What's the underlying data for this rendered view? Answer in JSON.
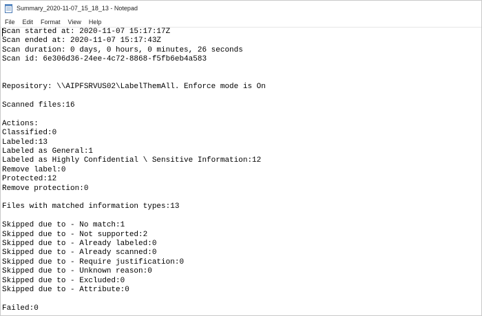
{
  "window": {
    "title": "Summary_2020-11-07_15_18_13 - Notepad"
  },
  "menu": {
    "items": [
      "File",
      "Edit",
      "Format",
      "View",
      "Help"
    ]
  },
  "document": {
    "lines": [
      "Scan started at: 2020-11-07 15:17:17Z",
      "Scan ended at: 2020-11-07 15:17:43Z",
      "Scan duration: 0 days, 0 hours, 0 minutes, 26 seconds",
      "Scan id: 6e306d36-24ee-4c72-8868-f5fb6eb4a583",
      "",
      "",
      "Repository: \\\\AIPFSRVUS02\\LabelThemAll. Enforce mode is On",
      "",
      "Scanned files:16",
      "",
      "Actions:",
      "Classified:0",
      "Labeled:13",
      "Labeled as General:1",
      "Labeled as Highly Confidential \\ Sensitive Information:12",
      "Remove label:0",
      "Protected:12",
      "Remove protection:0",
      "",
      "Files with matched information types:13",
      "",
      "Skipped due to - No match:1",
      "Skipped due to - Not supported:2",
      "Skipped due to - Already labeled:0",
      "Skipped due to - Already scanned:0",
      "Skipped due to - Require justification:0",
      "Skipped due to - Unknown reason:0",
      "Skipped due to - Excluded:0",
      "Skipped due to - Attribute:0",
      "",
      "Failed:0"
    ]
  },
  "icons": {
    "app": "notepad-icon"
  }
}
